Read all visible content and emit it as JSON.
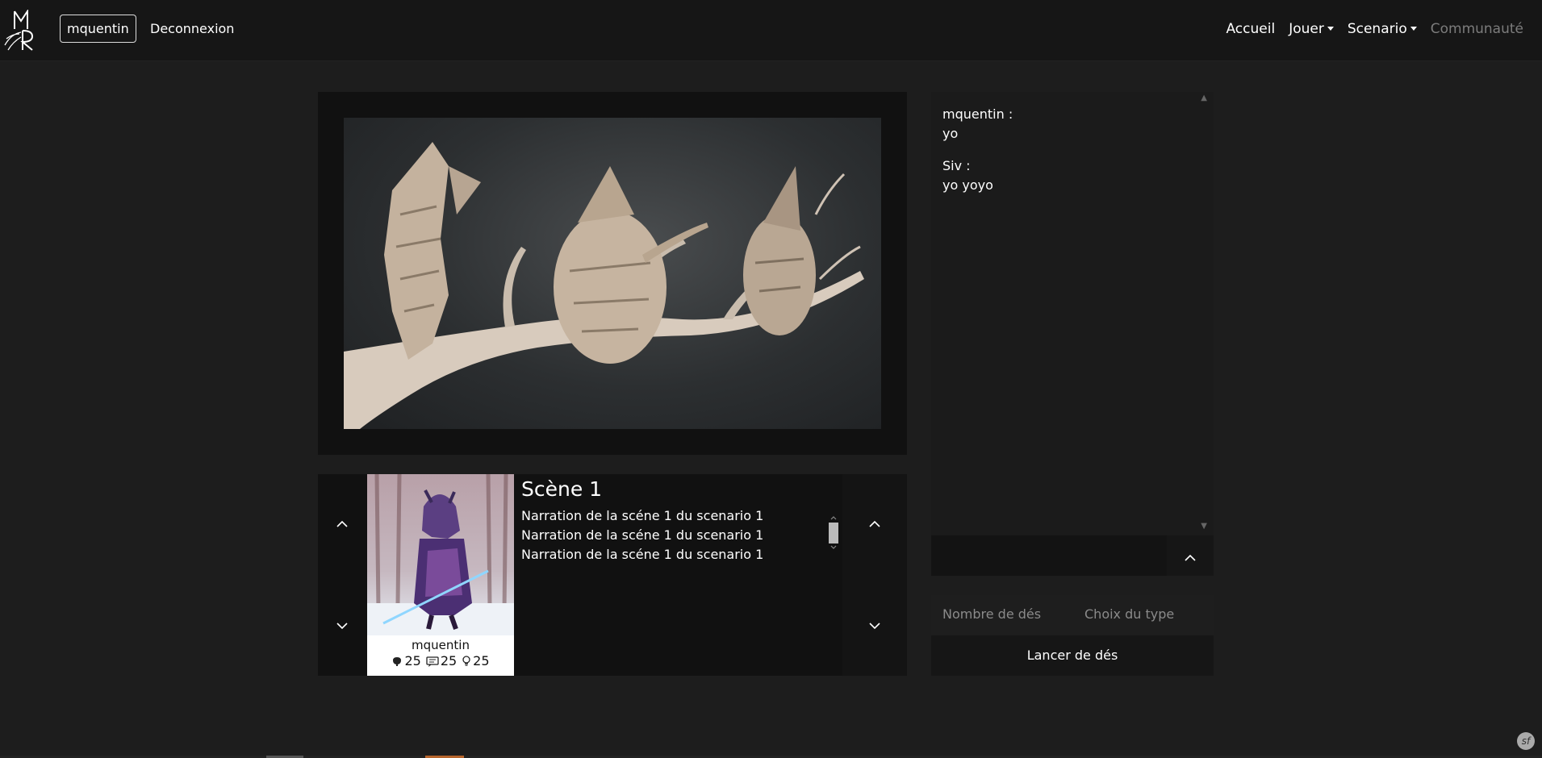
{
  "navbar": {
    "logo_text": "MR",
    "username": "mquentin",
    "logout": "Deconnexion",
    "links": [
      {
        "label": "Accueil",
        "dropdown": false,
        "disabled": false
      },
      {
        "label": "Jouer",
        "dropdown": true,
        "disabled": false
      },
      {
        "label": "Scenario",
        "dropdown": true,
        "disabled": false
      },
      {
        "label": "Communauté",
        "dropdown": false,
        "disabled": true
      }
    ]
  },
  "scene": {
    "title": "Scène 1",
    "narration": "Narration de la scéne 1 du scenario 1 Narration de la scéne 1 du scenario 1 Narration de la scéne 1 du scenario 1"
  },
  "character": {
    "name": "mquentin",
    "stats": [
      {
        "icon": "brain-icon",
        "value": "25"
      },
      {
        "icon": "speech-icon",
        "value": "25"
      },
      {
        "icon": "lightbulb-icon",
        "value": "25"
      }
    ]
  },
  "chat": {
    "messages": [
      {
        "author": "mquentin :",
        "text": "yo"
      },
      {
        "author": "Siv :",
        "text": "yo yoyo"
      }
    ],
    "input_value": ""
  },
  "dice": {
    "count_placeholder": "Nombre de dés",
    "type_placeholder": "Choix du type",
    "roll_label": "Lancer de dés"
  },
  "colors": {
    "background": "#1d1d1d",
    "navbar": "#161616",
    "panel": "#111111",
    "disabled_link": "#7c7c7c"
  }
}
